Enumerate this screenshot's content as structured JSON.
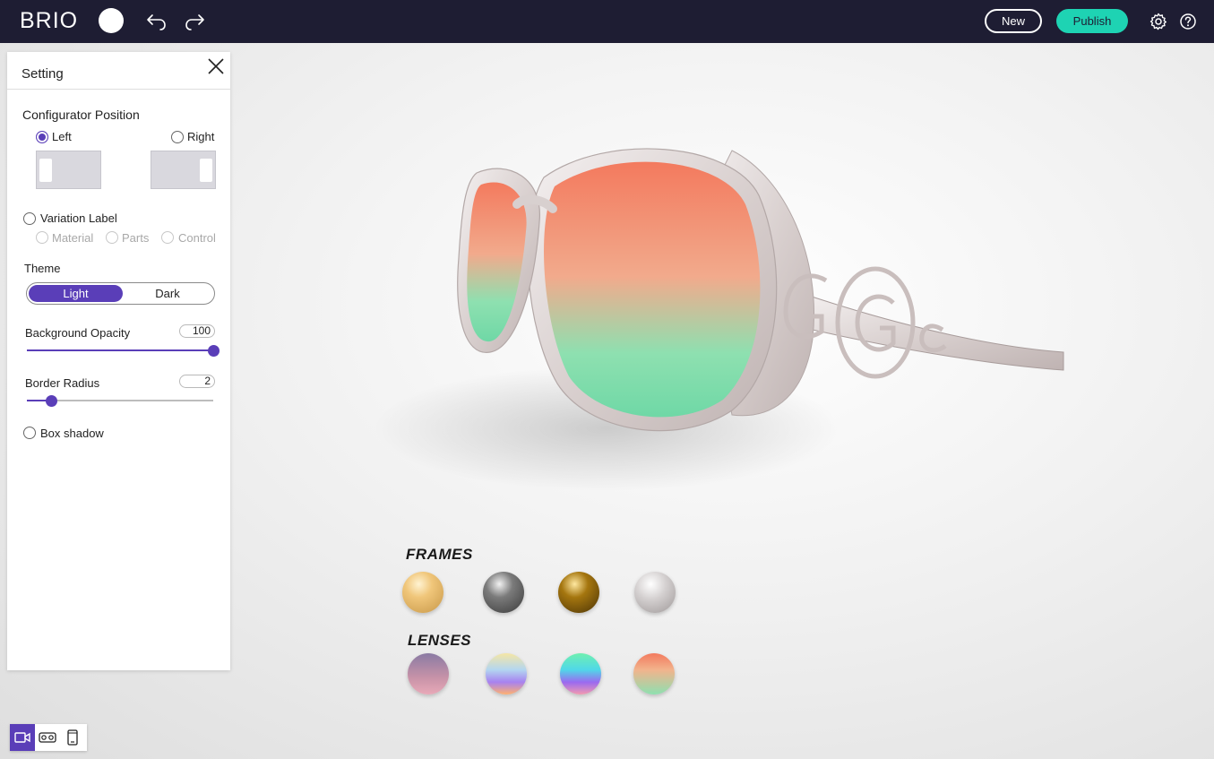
{
  "app": {
    "logo": "BRIO"
  },
  "topbar": {
    "new_label": "New",
    "publish_label": "Publish",
    "accent_color": "#1ed3b3",
    "bg_color": "#1e1d33"
  },
  "panel": {
    "title": "Setting",
    "configurator_position": {
      "title": "Configurator Position",
      "left_label": "Left",
      "right_label": "Right",
      "selected": "Left"
    },
    "variation_label": {
      "title": "Variation Label",
      "options": [
        "Material",
        "Parts",
        "Control"
      ],
      "enabled": false
    },
    "theme": {
      "title": "Theme",
      "light_label": "Light",
      "dark_label": "Dark",
      "selected": "Light"
    },
    "background_opacity": {
      "label": "Background Opacity",
      "value": "100",
      "fraction": 1.0
    },
    "border_radius": {
      "label": "Border Radius",
      "value": "2",
      "fraction": 0.13
    },
    "box_shadow": {
      "label": "Box shadow",
      "enabled": false
    },
    "accent_color": "#5a3eb8"
  },
  "configurator": {
    "frames_title": "FRAMES",
    "lenses_title": "LENSES",
    "frames": [
      "gold-swatch",
      "gunmetal-swatch",
      "bronze-swatch",
      "silver-swatch"
    ],
    "lenses": [
      "mauve-gradient-swatch",
      "rainbow-swatch",
      "aqua-violet-swatch",
      "coral-mint-swatch"
    ]
  },
  "view_modes": [
    "camera-view",
    "vr-view",
    "mobile-view"
  ],
  "active_view": "camera-view"
}
